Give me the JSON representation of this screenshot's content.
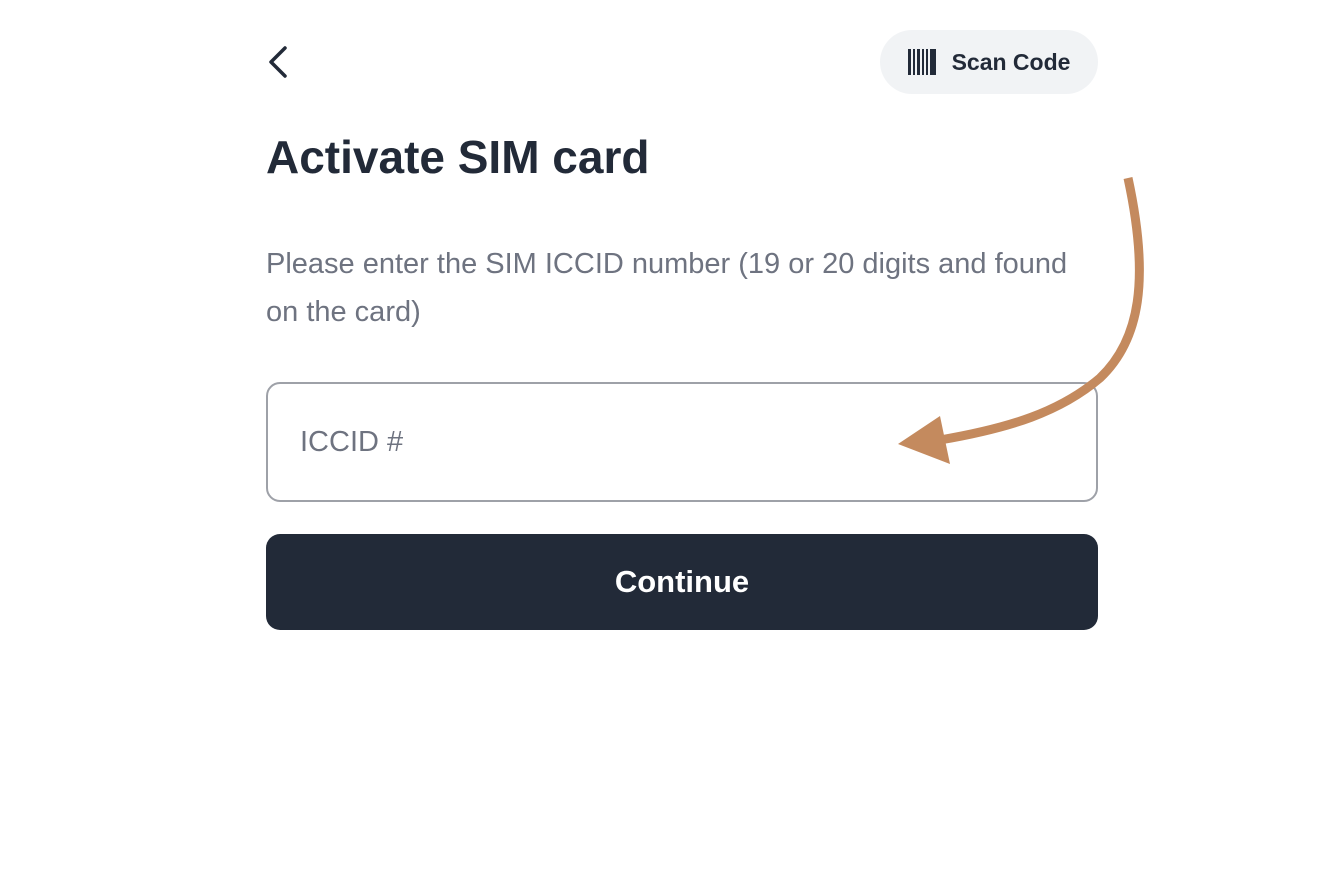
{
  "header": {
    "back_icon": "chevron-left-icon",
    "scan_button": {
      "icon": "barcode-icon",
      "label": "Scan Code"
    }
  },
  "main": {
    "title": "Activate SIM card",
    "instructions": "Please enter the SIM ICCID number (19 or 20 digits and found on the card)",
    "iccid_input": {
      "value": "",
      "placeholder": "ICCID #"
    },
    "continue_label": "Continue"
  },
  "annotation": {
    "icon": "curved-arrow-icon",
    "color": "#c48a5e"
  },
  "colors": {
    "text_dark": "#222a38",
    "text_muted": "#6e7380",
    "scan_button_bg": "#f1f3f5",
    "input_border": "#9ea1a8",
    "button_bg": "#222a38"
  }
}
